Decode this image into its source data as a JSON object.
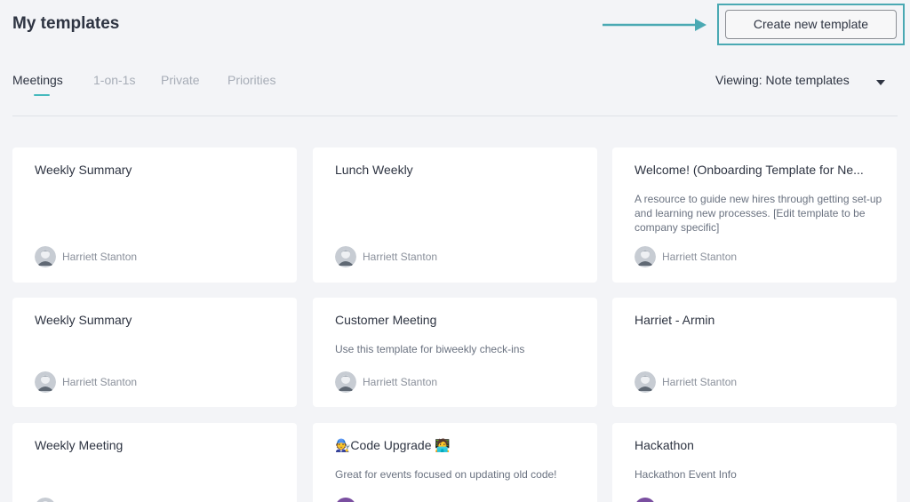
{
  "header": {
    "title": "My templates",
    "create_button_label": "Create new template"
  },
  "tabs": [
    {
      "label": "Meetings",
      "active": true
    },
    {
      "label": "1-on-1s",
      "active": false
    },
    {
      "label": "Private",
      "active": false
    },
    {
      "label": "Priorities",
      "active": false
    }
  ],
  "viewing": {
    "label": "Viewing: Note templates"
  },
  "colors": {
    "accent": "#45b9bd",
    "highlight_frame": "#4aa9b3",
    "background": "#f3f4f7",
    "avatar_purple": "#7a4fa0"
  },
  "cards": [
    {
      "title": "Weekly Summary",
      "description": "",
      "author": "Harriett Stanton"
    },
    {
      "title": "Lunch Weekly",
      "description": "",
      "author": "Harriett Stanton"
    },
    {
      "title": "Welcome! (Onboarding Template for Ne...",
      "description": "A resource to guide new hires through getting set-up and learning new processes. [Edit template to be company specific]",
      "author": "Harriett Stanton"
    },
    {
      "title": "Weekly Summary",
      "description": "",
      "author": "Harriett Stanton"
    },
    {
      "title": "Customer Meeting",
      "description": "Use this template for biweekly check-ins",
      "author": "Harriett Stanton"
    },
    {
      "title": "Harriet - Armin",
      "description": "",
      "author": "Harriett Stanton"
    },
    {
      "title": "Weekly Meeting",
      "description": "",
      "author": ""
    },
    {
      "title": "🧑‍🔧Code Upgrade 🧑‍💻",
      "description": "Great for events focused on updating old code!",
      "author": ""
    },
    {
      "title": "Hackathon",
      "description": "Hackathon Event Info",
      "author": ""
    }
  ]
}
